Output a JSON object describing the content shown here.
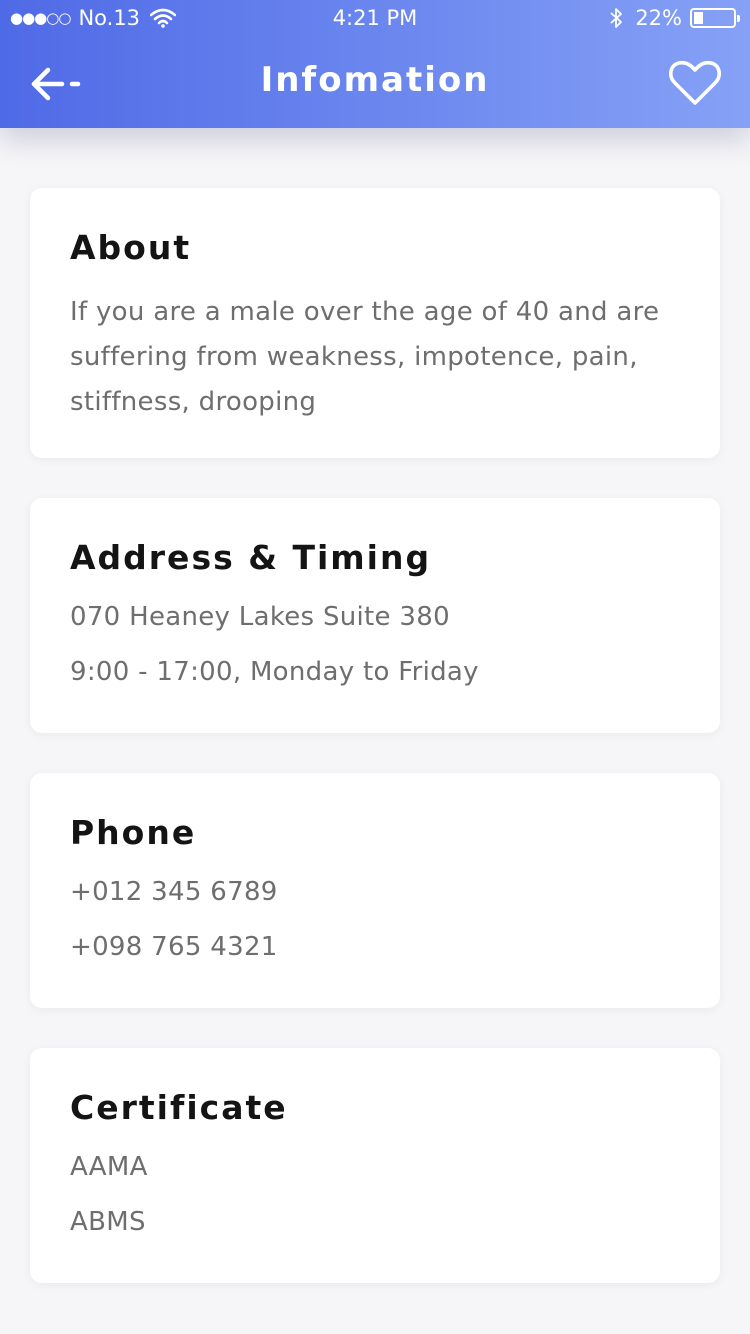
{
  "status_bar": {
    "signal": "●●●○○",
    "carrier": "No.13",
    "time": "4:21 PM",
    "battery": "22%"
  },
  "nav": {
    "title": "Infomation",
    "back_icon": "back-arrow-icon",
    "favorite_icon": "heart-icon"
  },
  "colors": {
    "header_gradient_start": "#4f6ae6",
    "header_gradient_end": "#86a1f6",
    "background": "#f6f6f8",
    "card": "#ffffff",
    "title_text": "#141414",
    "body_text": "#6e6e6e"
  },
  "about": {
    "title": "About",
    "text": "If you are a male over the age of 40 and are suffering from weakness, impotence, pain, stiffness, drooping"
  },
  "address": {
    "title": "Address & Timing",
    "lines": [
      "070 Heaney Lakes Suite 380",
      "9:00 - 17:00, Monday to Friday"
    ]
  },
  "phone": {
    "title": "Phone",
    "lines": [
      "+012 345 6789",
      "+098 765 4321"
    ]
  },
  "certificate": {
    "title": "Certificate",
    "lines": [
      "AAMA",
      "ABMS"
    ]
  }
}
